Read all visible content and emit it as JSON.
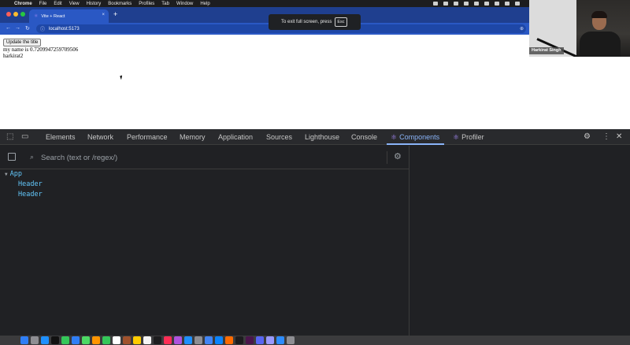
{
  "menubar": {
    "app": "Chrome",
    "items": [
      "File",
      "Edit",
      "View",
      "History",
      "Bookmarks",
      "Profiles",
      "Tab",
      "Window",
      "Help"
    ]
  },
  "browser": {
    "tab_title": "Vite + React",
    "tab_close": "×",
    "new_tab": "+",
    "url": "localhost:5173",
    "fullscreen_toast": "To exit full screen, press",
    "fullscreen_key": "Esc"
  },
  "page": {
    "button_label": "Update the title",
    "line1": "my name is 0.7209947259709506",
    "line2": "harkirat2"
  },
  "webcam": {
    "name_tag": "Harkirat Singh"
  },
  "devtools": {
    "tabs": [
      "Elements",
      "Network",
      "Performance",
      "Memory",
      "Application",
      "Sources",
      "Lighthouse",
      "Console",
      "Components",
      "Profiler"
    ],
    "active_tab": "Components",
    "search_placeholder": "Search (text or /regex/)",
    "tree": [
      {
        "label": "App",
        "depth": 0,
        "expanded": true
      },
      {
        "label": "Header",
        "depth": 1
      },
      {
        "label": "Header",
        "depth": 1
      }
    ]
  },
  "colors": {
    "chrome_tabstrip": "#1f3f8f",
    "devtools_bg": "#202124",
    "component_name": "#62c5f8",
    "active_tab": "#8ab4f8"
  }
}
